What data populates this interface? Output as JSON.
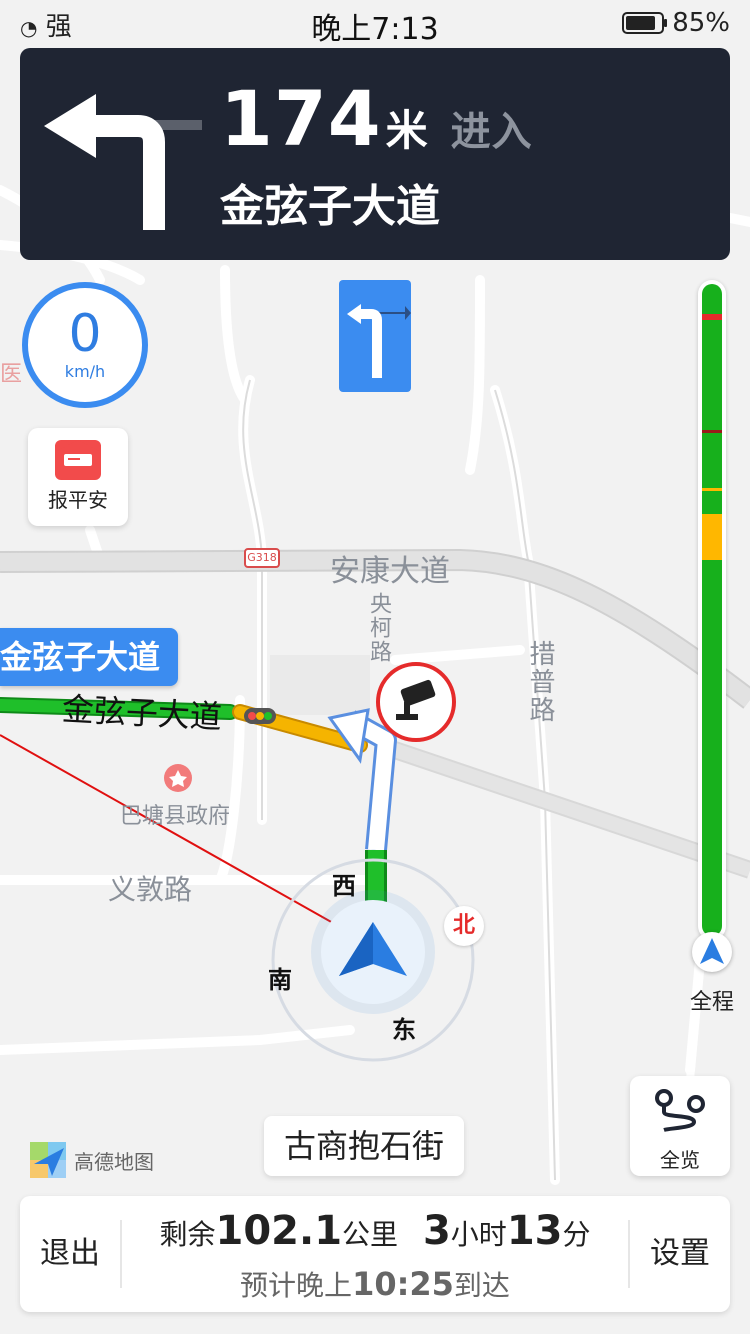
{
  "status_bar": {
    "signal_label": "强",
    "time": "晚上7:13",
    "battery_percent": "85%",
    "battery_level": 0.85
  },
  "guidance": {
    "distance_value": "174",
    "distance_unit": "米",
    "action": "进入",
    "road_name": "金弦子大道",
    "turn_icon": "turn-left-arrow-icon",
    "lane_icon": "left-turn-lane-icon"
  },
  "speed": {
    "value": "0",
    "unit": "km/h"
  },
  "safety_button": {
    "label": "报平安",
    "icon": "mail-envelope-icon",
    "color": "#f24b4b"
  },
  "traffic_bar": {
    "label": "全程",
    "colors": {
      "smooth": "#17b01c",
      "slow": "#ffb700",
      "congested": "#e52b2b"
    }
  },
  "map": {
    "labels": {
      "road_1": "安康大道",
      "road_2": "央柯路",
      "road_3": "措普路",
      "road_4": "义敦路",
      "road_5": "金弦子大道",
      "poi": "巴塘县政府",
      "hospital": "医",
      "highway_shield": "G318"
    },
    "road_tag": "金弦子大道",
    "compass": {
      "north": "北",
      "south": "南",
      "east": "东",
      "west": "西"
    }
  },
  "overview_button": {
    "label": "全览",
    "icon": "route-overview-icon"
  },
  "current_road": "古商抱石街",
  "logo_text": "高德地图",
  "bottom_bar": {
    "exit_label": "退出",
    "settings_label": "设置",
    "remaining_prefix": "剩余",
    "remaining_distance": "102.1",
    "distance_unit": "公里",
    "remaining_hours": "3",
    "hours_unit": "小时",
    "remaining_minutes": "13",
    "minutes_unit": "分",
    "eta_prefix": "预计晚上",
    "eta_time": "10:25",
    "eta_suffix": "到达"
  },
  "accent_color": "#3b8cf0"
}
